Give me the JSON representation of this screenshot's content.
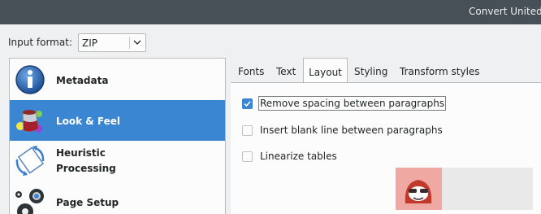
{
  "window": {
    "title": "Convert United"
  },
  "input_format": {
    "label": "Input format:",
    "value": "ZIP"
  },
  "sidebar": {
    "items": [
      {
        "label": "Metadata",
        "icon": "info-icon",
        "selected": false
      },
      {
        "label": "Look & Feel",
        "icon": "paint-bucket-icon",
        "selected": true
      },
      {
        "label": "Heuristic\nProcessing",
        "label_line1": "Heuristic",
        "label_line2": "Processing",
        "icon": "document-cycle-icon",
        "selected": false
      },
      {
        "label": "Page Setup",
        "icon": "gears-icon",
        "selected": false
      }
    ]
  },
  "tabs": [
    {
      "label": "Fonts",
      "active": false
    },
    {
      "label": "Text",
      "active": false
    },
    {
      "label": "Layout",
      "active": true
    },
    {
      "label": "Styling",
      "active": false
    },
    {
      "label": "Transform styles",
      "active": false
    }
  ],
  "layout_options": [
    {
      "label": "Remove spacing between paragraphs",
      "checked": true
    },
    {
      "label": "Insert blank line between paragraphs",
      "checked": false
    },
    {
      "label": "Linearize tables",
      "checked": false
    }
  ],
  "colors": {
    "accent": "#3b86d2",
    "titlebar": "#475057",
    "background": "#eff0f1"
  }
}
